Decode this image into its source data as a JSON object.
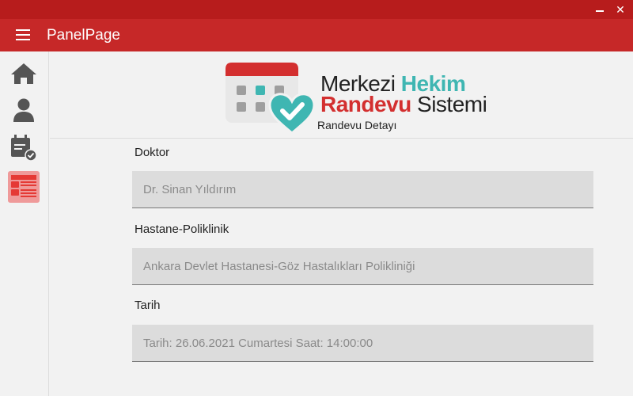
{
  "window": {
    "close_glyph": "✕"
  },
  "appbar": {
    "title": "PanelPage",
    "menu_icon": "hamburger-icon"
  },
  "sidebar": {
    "items": [
      {
        "icon": "home-icon"
      },
      {
        "icon": "user-icon"
      },
      {
        "icon": "calendar-check-icon"
      },
      {
        "icon": "appointment-list-icon",
        "active": true
      }
    ]
  },
  "logo": {
    "line1_a": "Merkezi ",
    "line1_b": "Hekim",
    "line2_a": "Randevu",
    "line2_b": " Sistemi"
  },
  "page": {
    "subtitle": "Randevu Detayı"
  },
  "form": {
    "doctor_label": "Doktor",
    "doctor_value": "Dr. Sinan Yıldırım",
    "hospital_label": "Hastane-Poliklinik",
    "hospital_value": "Ankara Devlet Hastanesi-Göz Hastalıkları Polikliniği",
    "date_label": "Tarih",
    "date_value": "Tarih: 26.06.2021 Cumartesi Saat: 14:00:00"
  },
  "colors": {
    "titlebar": "#b71c1c",
    "appbar": "#c62828",
    "teal": "#3fb6b2",
    "red": "#d32f2f",
    "active_bg": "#ef9a9a"
  }
}
